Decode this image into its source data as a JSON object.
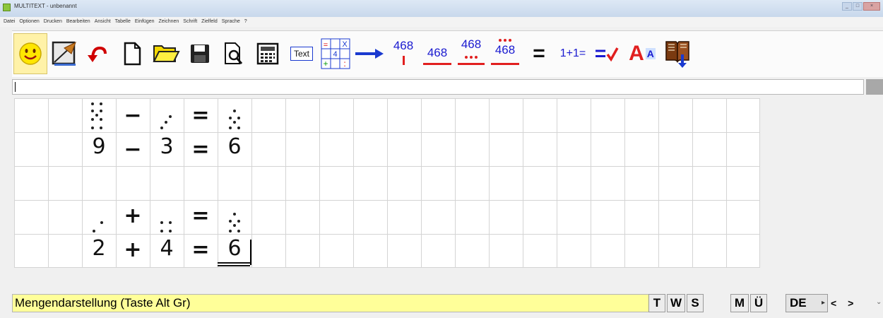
{
  "window": {
    "title": "MULTITEXT - unbenannt",
    "controls": [
      "_",
      "□",
      "×"
    ]
  },
  "menu": [
    "Datei",
    "Optionen",
    "Drucken",
    "Bearbeiten",
    "Ansicht",
    "Tabelle",
    "Einfügen",
    "Zeichnen",
    "Schrift",
    "Zielfeld",
    "Sprache",
    "?"
  ],
  "toolbar": {
    "text_button": "Text",
    "num_468": "468",
    "equals": "=",
    "one_plus_one": "1+1=",
    "check_equals": "=",
    "font_big": "A",
    "font_small": "A",
    "grid_x": "X",
    "grid_4": "4",
    "grid_eq": "=",
    "grid_plus": "+",
    "grid_colon": ":"
  },
  "worksheet": {
    "equation1": {
      "a": "9",
      "op": "−",
      "b": "3",
      "eq": "=",
      "c": "6"
    },
    "equation2": {
      "a": "2",
      "op": "+",
      "b": "4",
      "eq": "=",
      "c": "6"
    }
  },
  "status": {
    "message": "Mengendarstellung (Taste Alt Gr)",
    "keys": [
      "T",
      "W",
      "S",
      "M",
      "Ü"
    ],
    "language": "DE",
    "nav": "< >"
  },
  "colors": {
    "status_bg": "#ffff99",
    "accent_blue": "#1a1ad0",
    "accent_red": "#e11f1f"
  }
}
